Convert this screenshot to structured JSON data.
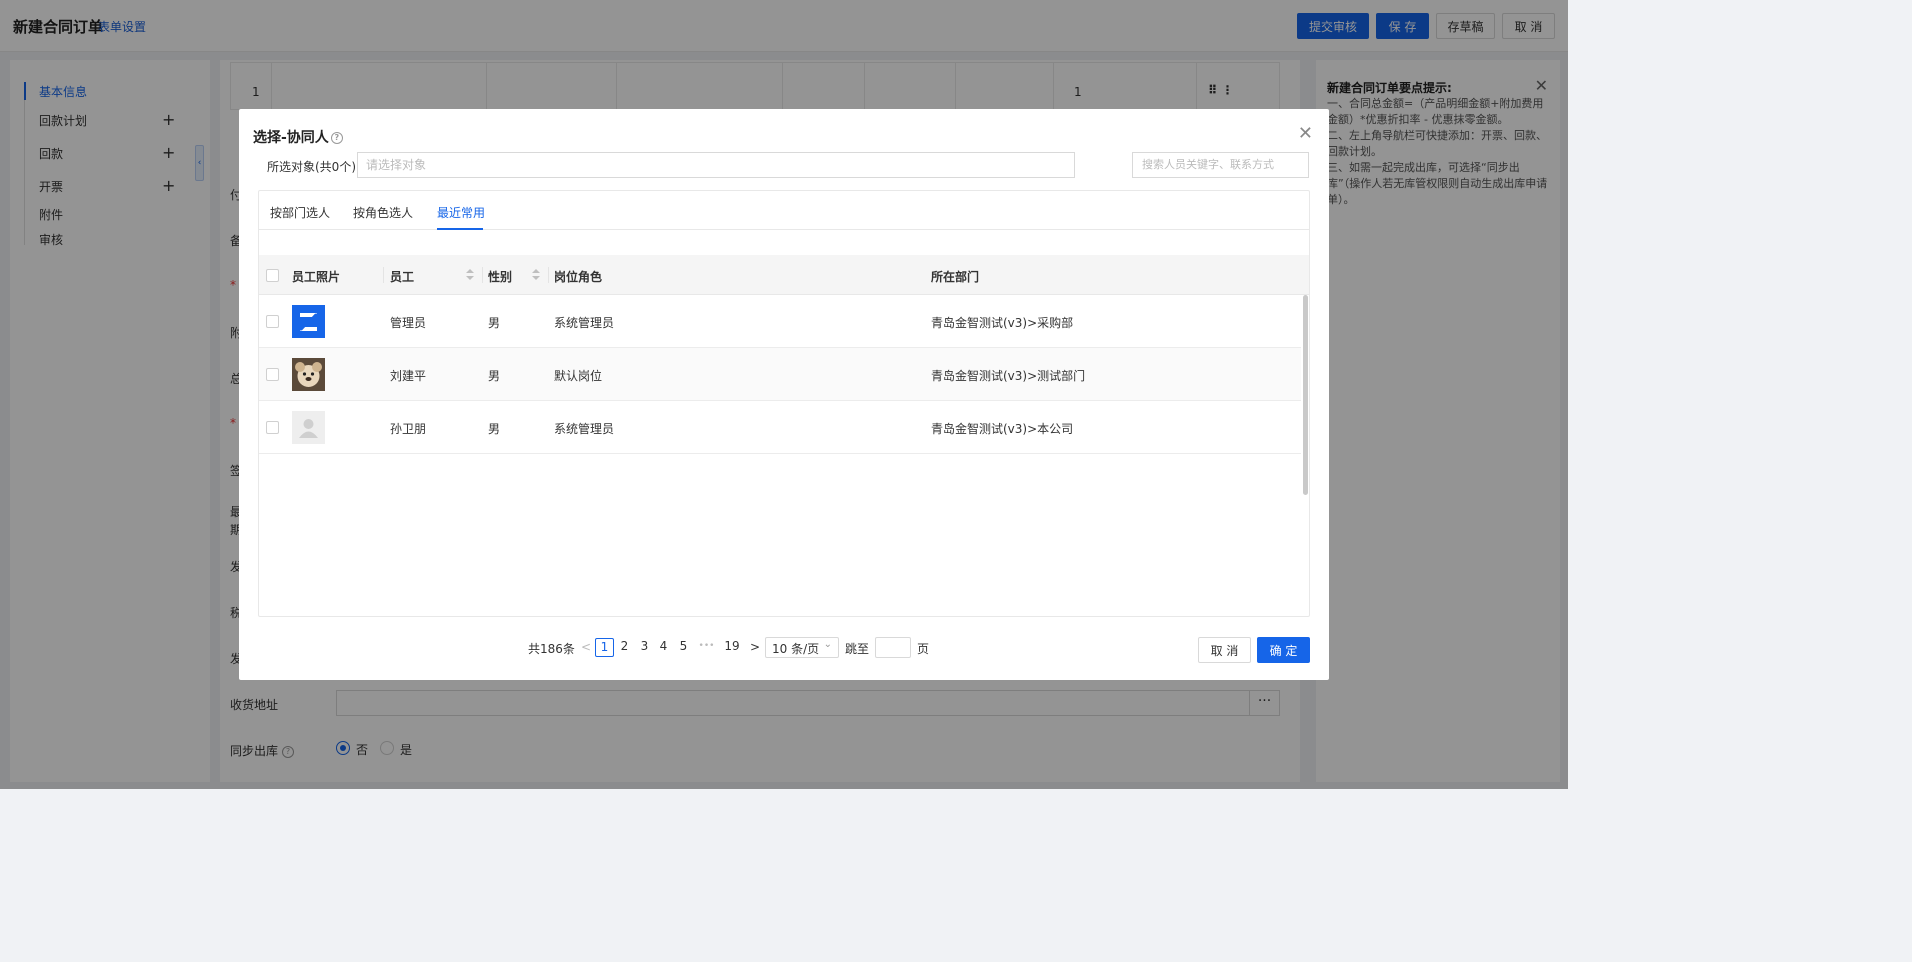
{
  "header": {
    "title": "新建合同订单",
    "form_settings": "表单设置",
    "buttons": {
      "submit": "提交审核",
      "save": "保 存",
      "draft": "存草稿",
      "cancel": "取 消"
    }
  },
  "left_nav": {
    "items": [
      {
        "label": "基本信息",
        "active": true,
        "plus": false
      },
      {
        "label": "回款计划",
        "active": false,
        "plus": true
      },
      {
        "label": "回款",
        "active": false,
        "plus": true
      },
      {
        "label": "开票",
        "active": false,
        "plus": true
      },
      {
        "label": "附件",
        "active": false,
        "plus": false
      },
      {
        "label": "审核",
        "active": false,
        "plus": false
      }
    ]
  },
  "main": {
    "row_index": "1",
    "row_qty": "1",
    "row_actions": "⠿ ⋮",
    "side_labels": [
      "付",
      "备",
      "*",
      "附",
      "总",
      "*",
      "签",
      "最",
      "期",
      "发",
      "税",
      "发"
    ],
    "address_label": "收货地址",
    "address_more": "···",
    "sync_label": "同步出库",
    "sync_help": "?",
    "sync_options": [
      "否",
      "是"
    ]
  },
  "tips": {
    "title": "新建合同订单要点提示:",
    "lines": [
      "一、合同总金额=（产品明细金额+附加费用金额）*优惠折扣率 - 优惠抹零金额。",
      "二、左上角导航栏可快捷添加：开票、回款、回款计划。",
      "三、如需一起完成出库，可选择“同步出库”（操作人若无库管权限则自动生成出库申请单）。"
    ]
  },
  "modal": {
    "title": "选择-协同人",
    "help": "?",
    "selected_label": "所选对象(共0个)",
    "selected_placeholder": "请选择对象",
    "search_placeholder": "搜索人员关键字、联系方式",
    "tabs": [
      "按部门选人",
      "按角色选人",
      "最近常用"
    ],
    "active_tab": 2,
    "columns": [
      "员工照片",
      "员工",
      "性别",
      "岗位角色",
      "所在部门"
    ],
    "rows": [
      {
        "name": "管理员",
        "gender": "男",
        "role": "系统管理员",
        "dept": "青岛金智测试(v3)>采购部",
        "photo": "logo"
      },
      {
        "name": "刘建平",
        "gender": "男",
        "role": "默认岗位",
        "dept": "青岛金智测试(v3)>测试部门",
        "photo": "dog"
      },
      {
        "name": "孙卫朋",
        "gender": "男",
        "role": "系统管理员",
        "dept": "青岛金智测试(v3)>本公司",
        "photo": "default"
      }
    ],
    "pagination": {
      "total": "共186条",
      "pages": [
        "1",
        "2",
        "3",
        "4",
        "5"
      ],
      "ellipsis": "•••",
      "last": "19",
      "current": 1,
      "page_size": "10 条/页",
      "jump_prefix": "跳至",
      "jump_suffix": "页"
    },
    "buttons": {
      "cancel": "取 消",
      "confirm": "确 定"
    }
  },
  "colors": {
    "primary": "#1665e8",
    "mask": "rgba(0,0,0,0.42)"
  }
}
